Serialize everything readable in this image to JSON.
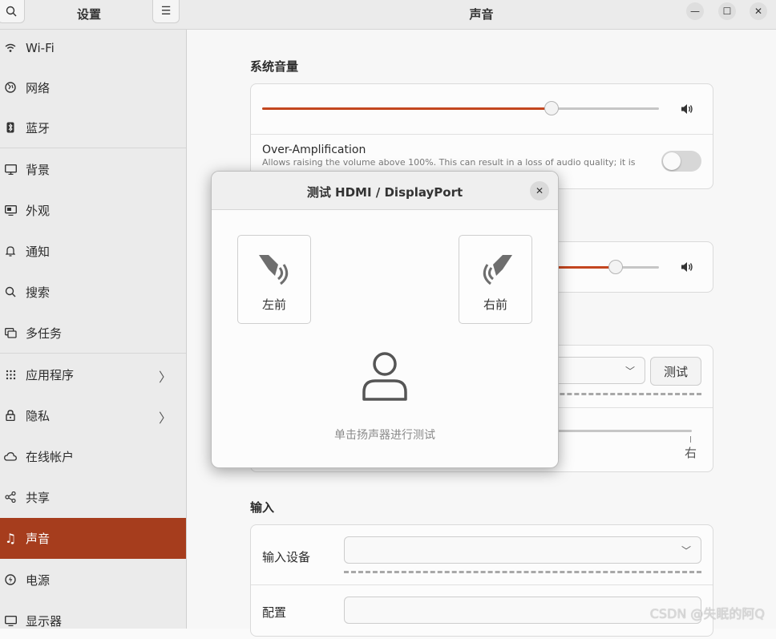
{
  "sidebar": {
    "title": "设置",
    "items": [
      {
        "label": "Wi-Fi",
        "icon": "wifi-icon"
      },
      {
        "label": "网络",
        "icon": "network-icon"
      },
      {
        "label": "蓝牙",
        "icon": "bluetooth-icon"
      },
      {
        "label": "背景",
        "icon": "background-icon"
      },
      {
        "label": "外观",
        "icon": "appearance-icon"
      },
      {
        "label": "通知",
        "icon": "bell-icon"
      },
      {
        "label": "搜索",
        "icon": "search-icon"
      },
      {
        "label": "多任务",
        "icon": "multitask-icon"
      },
      {
        "label": "应用程序",
        "icon": "apps-grid-icon"
      },
      {
        "label": "隐私",
        "icon": "lock-icon"
      },
      {
        "label": "在线帐户",
        "icon": "cloud-icon"
      },
      {
        "label": "共享",
        "icon": "share-icon"
      },
      {
        "label": "声音",
        "icon": "music-note-icon"
      },
      {
        "label": "电源",
        "icon": "power-icon"
      },
      {
        "label": "显示器",
        "icon": "display-icon"
      }
    ]
  },
  "main": {
    "title": "声音",
    "system_volume": {
      "section_title": "系统音量",
      "volume_level": 0.73,
      "over_amplification_title": "Over-Amplification",
      "over_amplification_desc": "Allows raising the volume above 100%. This can result in a loss of audio quality; it is",
      "over_amplification_enabled": false
    },
    "output_volume_level": 0.89,
    "test_button": "测试",
    "balance_right_label": "右",
    "input": {
      "section_title": "输入",
      "device_label": "输入设备",
      "config_label": "配置"
    }
  },
  "dialog": {
    "title": "测试 HDMI / DisplayPort",
    "left_speaker": "左前",
    "right_speaker": "右前",
    "hint": "单击扬声器进行测试"
  },
  "watermark": "CSDN @失眠的阿Q",
  "colors": {
    "accent": "#c3461f",
    "sidebar_active": "#a63d1d"
  }
}
